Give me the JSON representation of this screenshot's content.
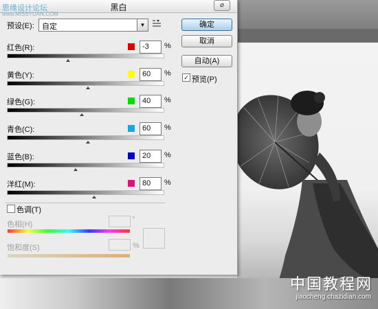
{
  "watermark": {
    "top_text": "思缘设计论坛",
    "top_url": "www.MISSYUAN.COM",
    "cn_text": "中国教程网",
    "url_text": "jiaocheng.chazidian.com"
  },
  "dialog": {
    "title": "黑白",
    "close_label": "⌀",
    "preset_label": "预设(E):",
    "preset_value": "自定",
    "percent_sign": "%",
    "sliders": [
      {
        "label": "红色(R):",
        "value": "-3",
        "level": -3,
        "color": "#e00000"
      },
      {
        "label": "黄色(Y):",
        "value": "60",
        "level": 60,
        "color": "#ffff00"
      },
      {
        "label": "绿色(G):",
        "value": "40",
        "level": 40,
        "color": "#00e000"
      },
      {
        "label": "青色(C):",
        "value": "60",
        "level": 60,
        "color": "#18a8e0"
      },
      {
        "label": "蓝色(B):",
        "value": "20",
        "level": 20,
        "color": "#0000c0"
      },
      {
        "label": "洋红(M):",
        "value": "80",
        "level": 80,
        "color": "#e0107a"
      }
    ],
    "slider_range": [
      -200,
      300
    ],
    "buttons": {
      "ok": "确定",
      "cancel": "取消",
      "auto": "自动(A)",
      "preview": "预览(P)",
      "preview_checked": true
    },
    "toning": {
      "label": "色调(T)",
      "hue_label": "色相(H)",
      "saturation_label": "饱和度(S)",
      "degree_sign": "°",
      "percent_sign": "%"
    }
  }
}
